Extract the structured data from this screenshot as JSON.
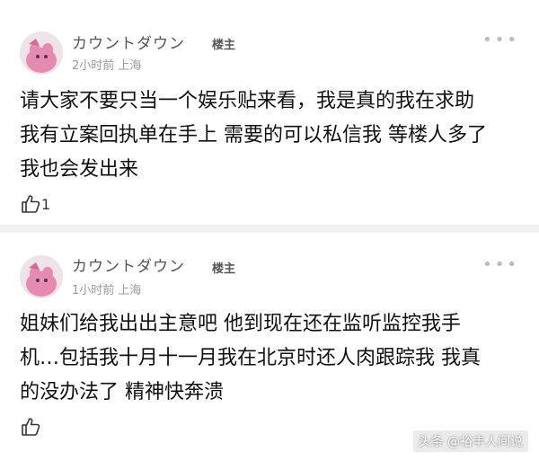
{
  "posts": [
    {
      "username": "カウントダウン",
      "badge": "楼主",
      "time": "2小时前",
      "location": "上海",
      "content_lines": [
        "请大家不要只当一个娱乐贴来看，我是真的我在求助",
        "我有立案回执单在手上 需要的可以私信我 等楼人多了",
        "我也会发出来"
      ],
      "likes": "1"
    },
    {
      "username": "カウントダウン",
      "badge": "楼主",
      "time": "1小时前",
      "location": "上海",
      "content_lines": [
        "姐妹们给我出出主意吧 他到现在还在监听监控我手",
        "机…包括我十月十一月我在北京时还人肉跟踪我 我真",
        "的没办法了 精神快奔溃"
      ],
      "likes": ""
    }
  ],
  "watermark": "头条 @裕丰人间说",
  "icons": {
    "more": "more-dots-icon",
    "like": "thumb-up-icon"
  }
}
